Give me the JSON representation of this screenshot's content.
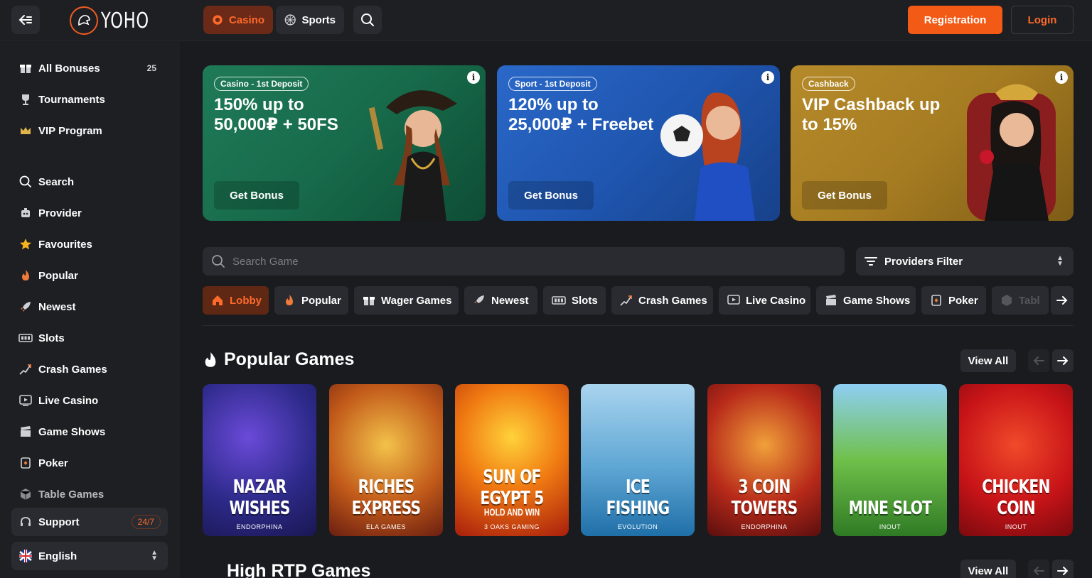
{
  "header": {
    "logo_text": "YOHO",
    "tabs": [
      {
        "label": "Casino"
      },
      {
        "label": "Sports"
      }
    ],
    "registration_label": "Registration",
    "login_label": "Login",
    "accent_color": "#f25a16"
  },
  "sidebar": {
    "items": [
      {
        "label": "All Bonuses",
        "count": "25",
        "icon": "gift-icon"
      },
      {
        "label": "Tournaments",
        "icon": "trophy-icon"
      },
      {
        "label": "VIP Program",
        "icon": "crown-icon"
      },
      {
        "label": "Search",
        "icon": "search-icon"
      },
      {
        "label": "Provider",
        "icon": "provider-icon"
      },
      {
        "label": "Favourites",
        "icon": "star-icon"
      },
      {
        "label": "Popular",
        "icon": "fire-icon"
      },
      {
        "label": "Newest",
        "icon": "rocket-icon"
      },
      {
        "label": "Slots",
        "icon": "slots-icon"
      },
      {
        "label": "Crash Games",
        "icon": "crash-icon"
      },
      {
        "label": "Live Casino",
        "icon": "live-icon"
      },
      {
        "label": "Game Shows",
        "icon": "clapper-icon"
      },
      {
        "label": "Poker",
        "icon": "cards-icon"
      },
      {
        "label": "Table Games",
        "icon": "dice-icon"
      }
    ],
    "support": {
      "label": "Support",
      "badge": "24/7"
    },
    "language": {
      "label": "English"
    }
  },
  "promos": [
    {
      "tag": "Casino - 1st Deposit",
      "headline": "150% up to 50,000₽ + 50FS",
      "button": "Get Bonus",
      "color": "#1f7a57"
    },
    {
      "tag": "Sport - 1st Deposit",
      "headline": "120% up to 25,000₽ + Freebet",
      "button": "Get Bonus",
      "color": "#2a68c8"
    },
    {
      "tag": "Cashback",
      "headline": "VIP Cashback up to 15%",
      "button": "Get Bonus",
      "color": "#b58a2a"
    }
  ],
  "search": {
    "placeholder": "Search Game"
  },
  "providers_filter": {
    "label": "Providers Filter"
  },
  "categories": [
    {
      "label": "Lobby",
      "active": true
    },
    {
      "label": "Popular"
    },
    {
      "label": "Wager Games"
    },
    {
      "label": "Newest"
    },
    {
      "label": "Slots"
    },
    {
      "label": "Crash Games"
    },
    {
      "label": "Live Casino"
    },
    {
      "label": "Game Shows"
    },
    {
      "label": "Poker"
    },
    {
      "label": "Tabl"
    }
  ],
  "popular_games": {
    "title": "Popular Games",
    "view_all": "View All",
    "games": [
      {
        "name": "NAZAR WISHES",
        "subtitle": "",
        "provider": "ENDORPHINA"
      },
      {
        "name": "RICHES EXPRESS",
        "subtitle": "",
        "provider": "ELA GAMES"
      },
      {
        "name": "SUN OF EGYPT 5",
        "subtitle": "HOLD AND WIN",
        "provider": "3 OAKS GAMING"
      },
      {
        "name": "ICE FISHING",
        "subtitle": "",
        "provider": "EVOLUTION"
      },
      {
        "name": "3 COIN TOWERS",
        "subtitle": "",
        "provider": "ENDORPHINA"
      },
      {
        "name": "MINE SLOT",
        "subtitle": "",
        "provider": "INOUT"
      },
      {
        "name": "CHICKEN COIN",
        "subtitle": "",
        "provider": "INOUT"
      }
    ]
  },
  "high_rtp": {
    "title": "High RTP Games",
    "view_all": "View All"
  }
}
